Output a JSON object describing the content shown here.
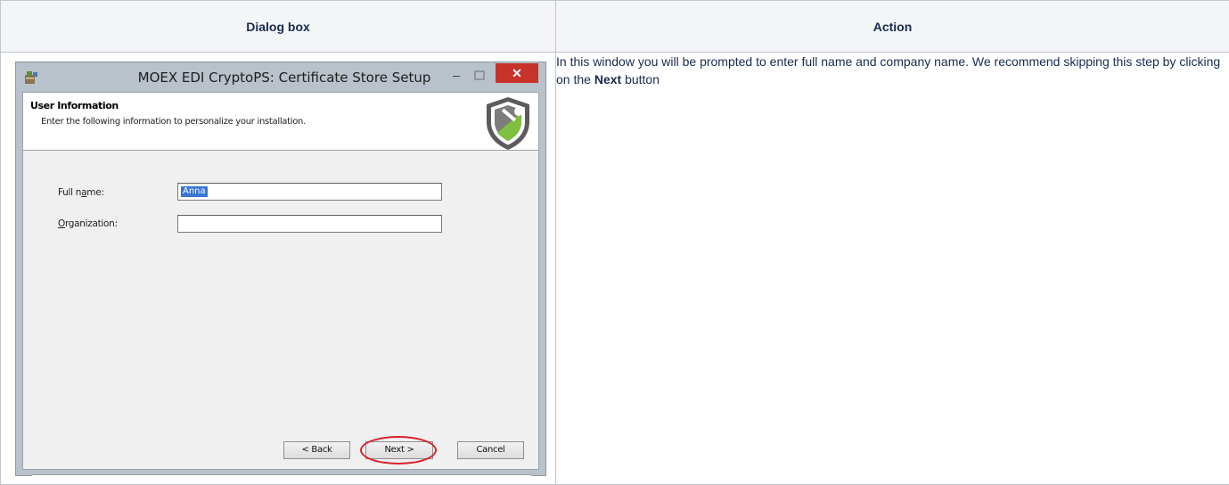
{
  "table": {
    "headers": [
      "Dialog box",
      "Action"
    ]
  },
  "dialog": {
    "title": "MOEX EDI CryptoPS: Certificate Store Setup",
    "controls": {
      "minimize": "–",
      "close": "✕"
    },
    "banner": {
      "title": "User Information",
      "subtitle": "Enter the following information to personalize your installation."
    },
    "fields": {
      "full_name": {
        "label_pre": "Full n",
        "label_accel": "a",
        "label_post": "me:",
        "value": "Anna"
      },
      "organization": {
        "label_pre": "",
        "label_accel": "O",
        "label_post": "rganization:",
        "value": ""
      }
    },
    "buttons": {
      "back": "< Back",
      "next": "Next >",
      "cancel": "Cancel"
    }
  },
  "action": {
    "text_before": "In this window you will be prompted to enter full name and company name. We recommend skipping this step by clicking on the ",
    "bold": "Next",
    "text_after": " button"
  },
  "colors": {
    "highlight": "#d9202a",
    "close_button": "#c7322a",
    "selection": "#3875d7"
  }
}
